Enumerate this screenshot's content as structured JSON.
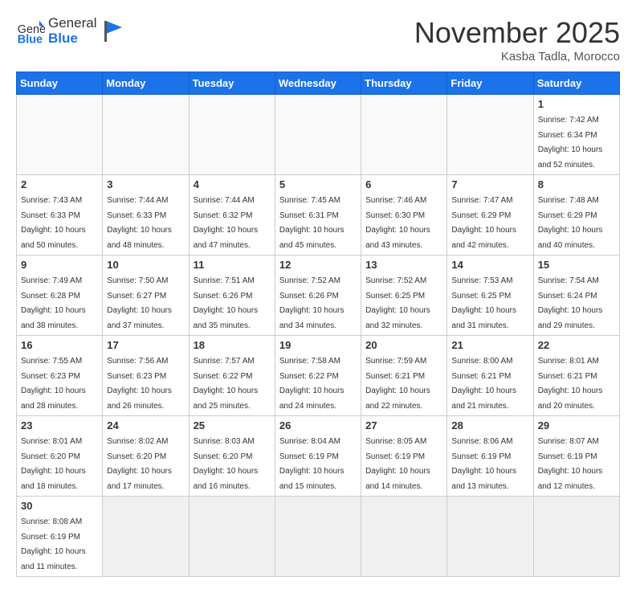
{
  "logo": {
    "text_general": "General",
    "text_blue": "Blue"
  },
  "title": "November 2025",
  "subtitle": "Kasba Tadla, Morocco",
  "weekdays": [
    "Sunday",
    "Monday",
    "Tuesday",
    "Wednesday",
    "Thursday",
    "Friday",
    "Saturday"
  ],
  "days": {
    "1": {
      "sunrise": "7:42 AM",
      "sunset": "6:34 PM",
      "daylight": "10 hours and 52 minutes."
    },
    "2": {
      "sunrise": "7:43 AM",
      "sunset": "6:33 PM",
      "daylight": "10 hours and 50 minutes."
    },
    "3": {
      "sunrise": "7:44 AM",
      "sunset": "6:33 PM",
      "daylight": "10 hours and 48 minutes."
    },
    "4": {
      "sunrise": "7:44 AM",
      "sunset": "6:32 PM",
      "daylight": "10 hours and 47 minutes."
    },
    "5": {
      "sunrise": "7:45 AM",
      "sunset": "6:31 PM",
      "daylight": "10 hours and 45 minutes."
    },
    "6": {
      "sunrise": "7:46 AM",
      "sunset": "6:30 PM",
      "daylight": "10 hours and 43 minutes."
    },
    "7": {
      "sunrise": "7:47 AM",
      "sunset": "6:29 PM",
      "daylight": "10 hours and 42 minutes."
    },
    "8": {
      "sunrise": "7:48 AM",
      "sunset": "6:29 PM",
      "daylight": "10 hours and 40 minutes."
    },
    "9": {
      "sunrise": "7:49 AM",
      "sunset": "6:28 PM",
      "daylight": "10 hours and 38 minutes."
    },
    "10": {
      "sunrise": "7:50 AM",
      "sunset": "6:27 PM",
      "daylight": "10 hours and 37 minutes."
    },
    "11": {
      "sunrise": "7:51 AM",
      "sunset": "6:26 PM",
      "daylight": "10 hours and 35 minutes."
    },
    "12": {
      "sunrise": "7:52 AM",
      "sunset": "6:26 PM",
      "daylight": "10 hours and 34 minutes."
    },
    "13": {
      "sunrise": "7:52 AM",
      "sunset": "6:25 PM",
      "daylight": "10 hours and 32 minutes."
    },
    "14": {
      "sunrise": "7:53 AM",
      "sunset": "6:25 PM",
      "daylight": "10 hours and 31 minutes."
    },
    "15": {
      "sunrise": "7:54 AM",
      "sunset": "6:24 PM",
      "daylight": "10 hours and 29 minutes."
    },
    "16": {
      "sunrise": "7:55 AM",
      "sunset": "6:23 PM",
      "daylight": "10 hours and 28 minutes."
    },
    "17": {
      "sunrise": "7:56 AM",
      "sunset": "6:23 PM",
      "daylight": "10 hours and 26 minutes."
    },
    "18": {
      "sunrise": "7:57 AM",
      "sunset": "6:22 PM",
      "daylight": "10 hours and 25 minutes."
    },
    "19": {
      "sunrise": "7:58 AM",
      "sunset": "6:22 PM",
      "daylight": "10 hours and 24 minutes."
    },
    "20": {
      "sunrise": "7:59 AM",
      "sunset": "6:21 PM",
      "daylight": "10 hours and 22 minutes."
    },
    "21": {
      "sunrise": "8:00 AM",
      "sunset": "6:21 PM",
      "daylight": "10 hours and 21 minutes."
    },
    "22": {
      "sunrise": "8:01 AM",
      "sunset": "6:21 PM",
      "daylight": "10 hours and 20 minutes."
    },
    "23": {
      "sunrise": "8:01 AM",
      "sunset": "6:20 PM",
      "daylight": "10 hours and 18 minutes."
    },
    "24": {
      "sunrise": "8:02 AM",
      "sunset": "6:20 PM",
      "daylight": "10 hours and 17 minutes."
    },
    "25": {
      "sunrise": "8:03 AM",
      "sunset": "6:20 PM",
      "daylight": "10 hours and 16 minutes."
    },
    "26": {
      "sunrise": "8:04 AM",
      "sunset": "6:19 PM",
      "daylight": "10 hours and 15 minutes."
    },
    "27": {
      "sunrise": "8:05 AM",
      "sunset": "6:19 PM",
      "daylight": "10 hours and 14 minutes."
    },
    "28": {
      "sunrise": "8:06 AM",
      "sunset": "6:19 PM",
      "daylight": "10 hours and 13 minutes."
    },
    "29": {
      "sunrise": "8:07 AM",
      "sunset": "6:19 PM",
      "daylight": "10 hours and 12 minutes."
    },
    "30": {
      "sunrise": "8:08 AM",
      "sunset": "6:19 PM",
      "daylight": "10 hours and 11 minutes."
    }
  }
}
